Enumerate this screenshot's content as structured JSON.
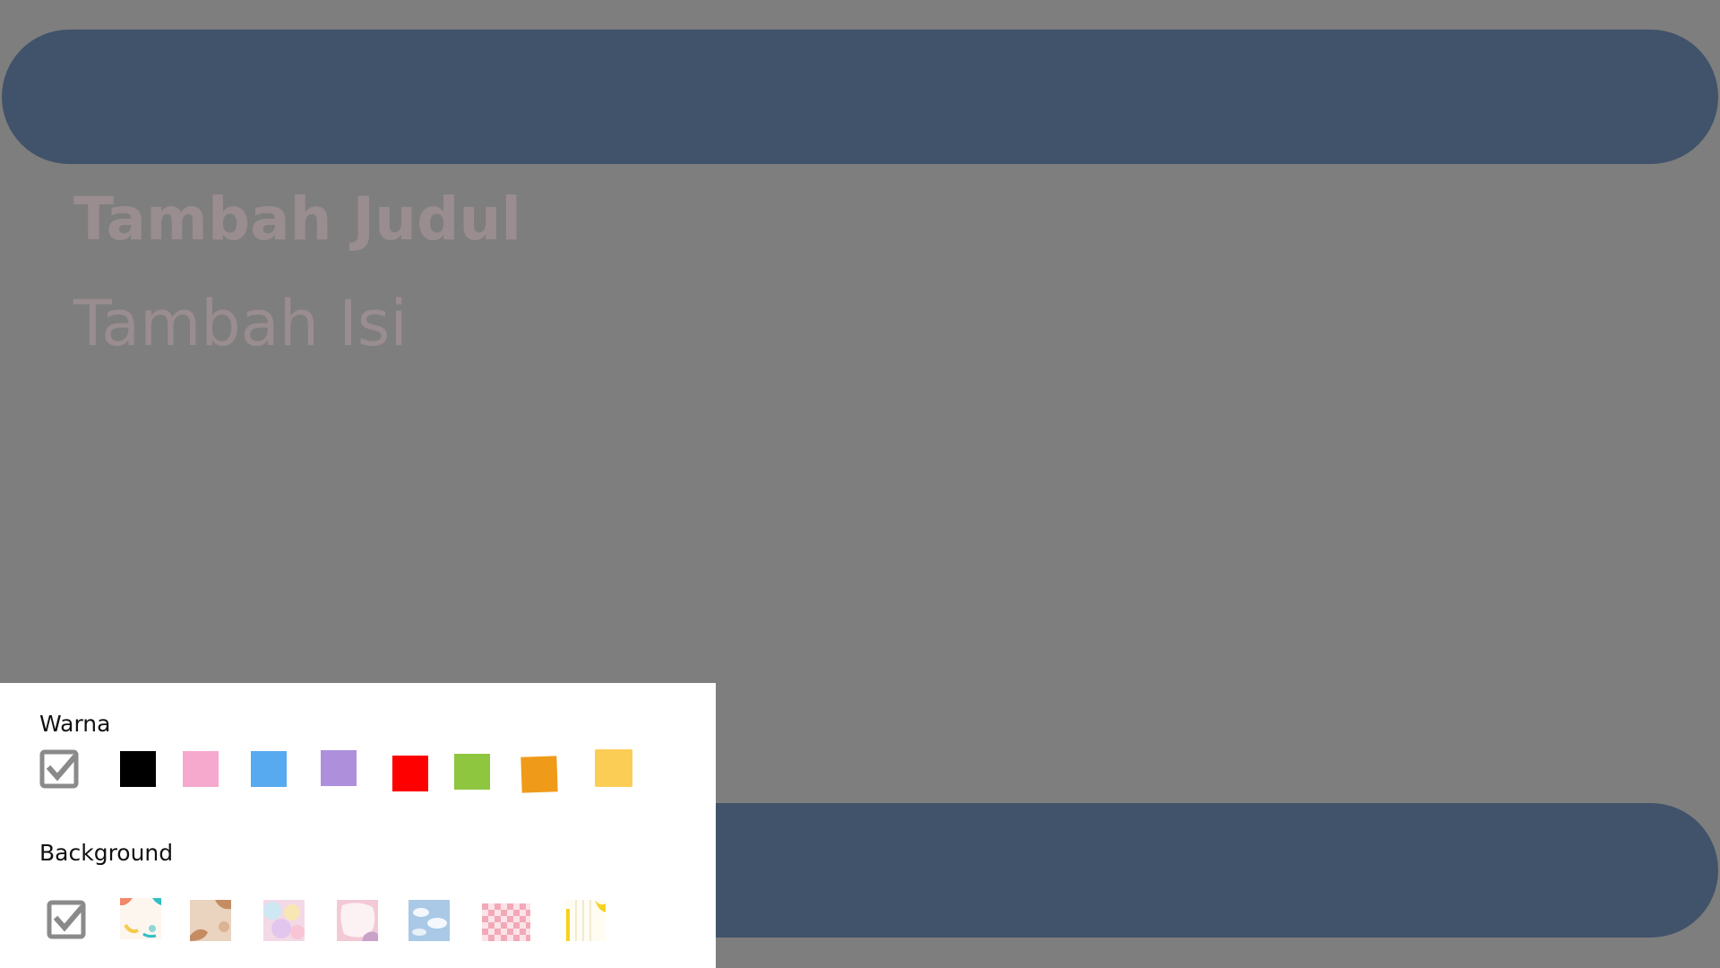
{
  "slide": {
    "title": "Tambah Judul",
    "body": "Tambah Isi",
    "bar_color": "#41536a",
    "background_color": "#7e7e7e"
  },
  "panel": {
    "color_label": "Warna",
    "background_label": "Background",
    "colors": [
      "#000000",
      "#f7a8cd",
      "#58aaf0",
      "#ad8fdc",
      "#ff0000",
      "#8ec63f",
      "#f09a1a",
      "#fccd55"
    ],
    "background_thumbnails": [
      "confetti-pattern",
      "brown-blobs-pattern",
      "pastel-watercolor-pattern",
      "pink-blob-pattern",
      "sky-clouds-pattern",
      "pink-checker-pattern",
      "yellow-stripes-pattern"
    ]
  }
}
